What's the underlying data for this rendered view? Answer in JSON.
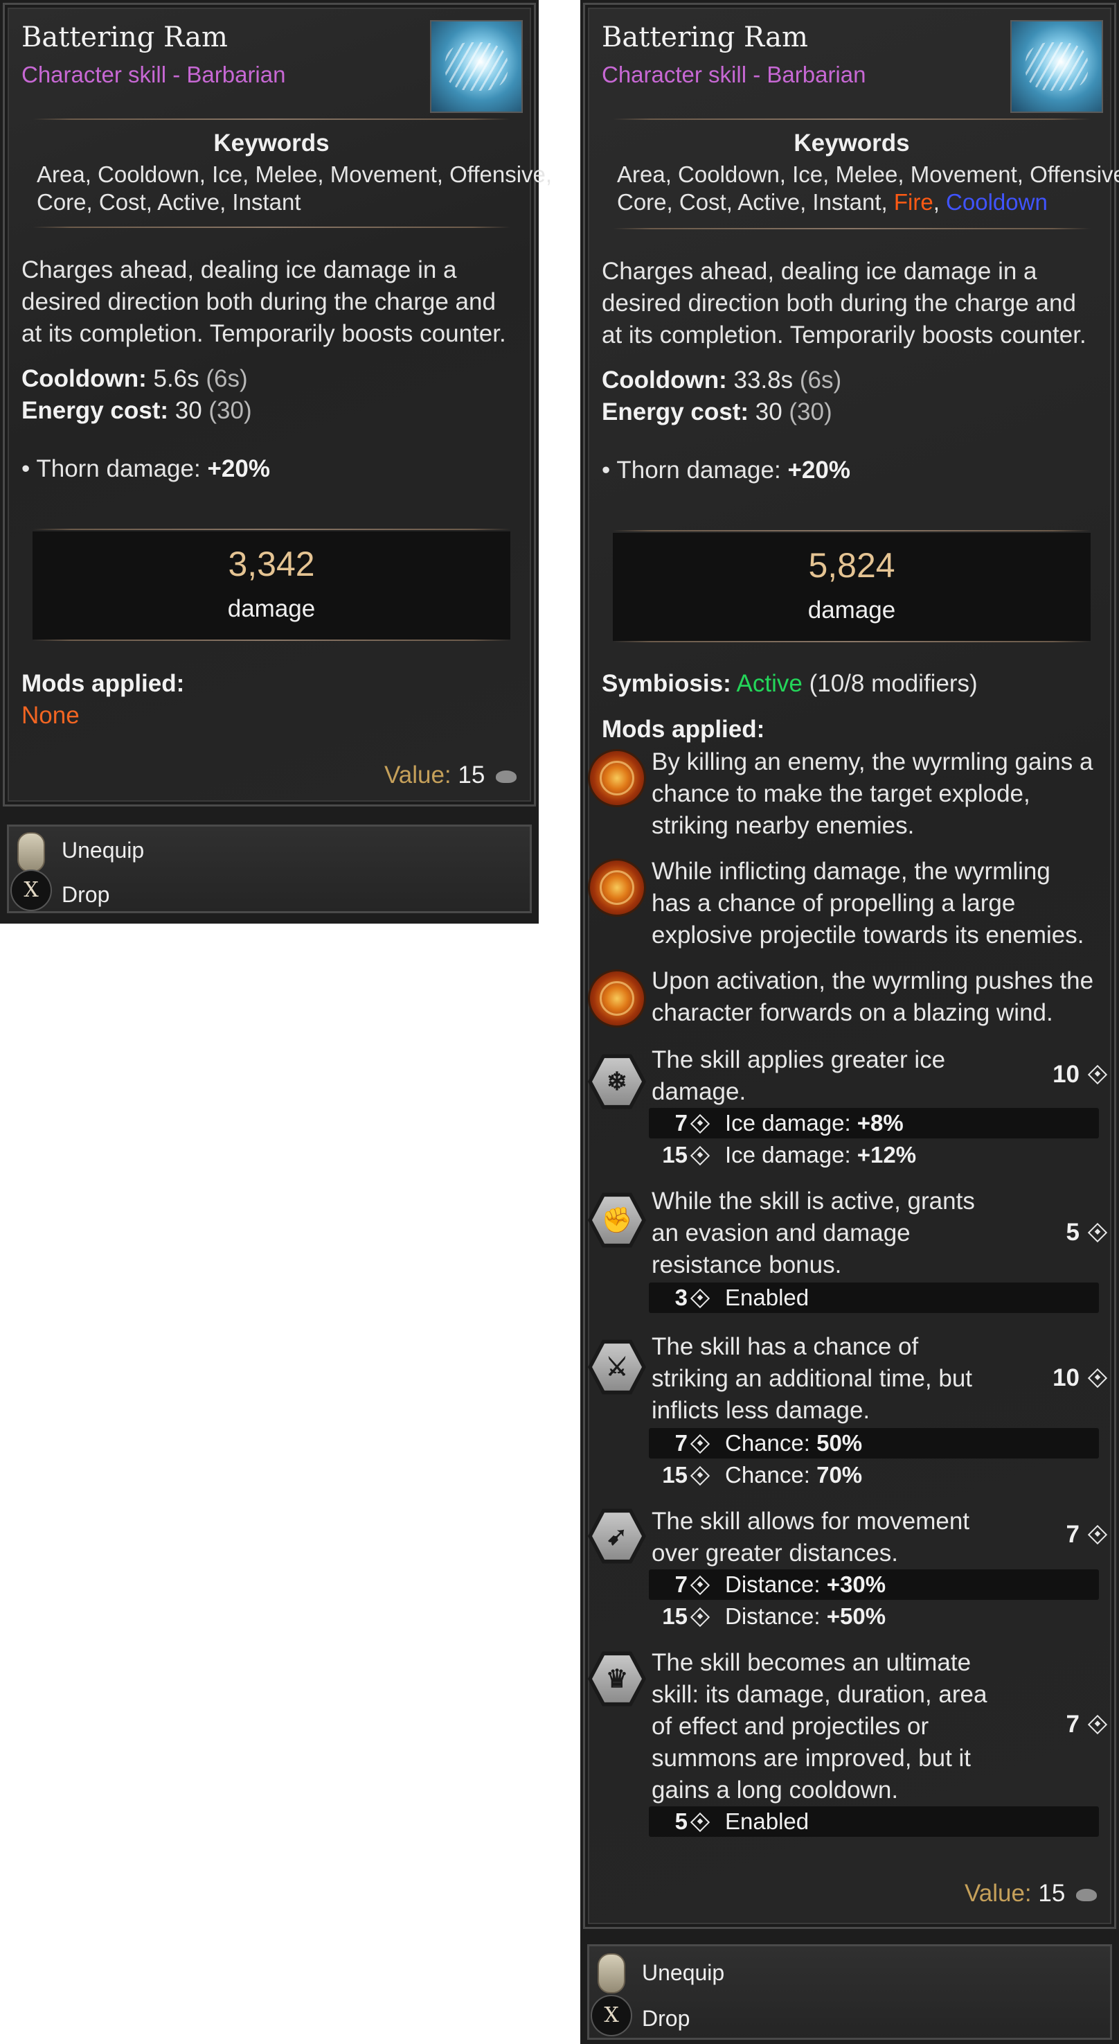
{
  "left": {
    "title": "Battering Ram",
    "subtitle": "Character skill - Barbarian",
    "keywords_title": "Keywords",
    "keywords_line1": "Area, Cooldown, Ice, Melee, Movement, Offensive,",
    "keywords_line2": "Core, Cost, Active, Instant",
    "description": "Charges ahead, dealing ice damage in a desired direction both during the charge and at its completion. Temporarily boosts counter.",
    "cooldown_label": "Cooldown:",
    "cooldown_value": "5.6s",
    "cooldown_base": "(6s)",
    "energy_label": "Energy cost:",
    "energy_value": "30",
    "energy_base": "(30)",
    "thorn_label": "• Thorn damage:",
    "thorn_value": "+20%",
    "damage_value": "3,342",
    "damage_label": "damage",
    "mods_label": "Mods applied:",
    "mods_none": "None",
    "value_label": "Value:",
    "value_amount": "15",
    "unequip": "Unequip",
    "drop": "Drop",
    "drop_key": "X"
  },
  "right": {
    "title": "Battering Ram",
    "subtitle": "Character skill - Barbarian",
    "keywords_title": "Keywords",
    "keywords_line1": "Area, Cooldown, Ice, Melee, Movement, Offensive,",
    "keywords_line2_plain": "Core, Cost, Active, Instant,",
    "keyword_fire": "Fire",
    "keyword_sep": ",",
    "keyword_cooldown": "Cooldown",
    "description": "Charges ahead, dealing ice damage in a desired direction both during the charge and at its completion. Temporarily boosts counter.",
    "cooldown_label": "Cooldown:",
    "cooldown_value": "33.8s",
    "cooldown_base": "(6s)",
    "energy_label": "Energy cost:",
    "energy_value": "30",
    "energy_base": "(30)",
    "thorn_label": "• Thorn damage:",
    "thorn_value": "+20%",
    "damage_value": "5,824",
    "damage_label": "damage",
    "symbiosis_label": "Symbiosis:",
    "symbiosis_status": "Active",
    "symbiosis_detail": "(10/8 modifiers)",
    "mods_label": "Mods applied:",
    "wyrmling_mods": [
      "By killing an enemy, the wyrmling gains a chance to make the target explode, striking nearby enemies.",
      "While inflicting damage, the wyrmling has a chance of propelling a large explosive projectile towards its enemies.",
      "Upon activation, the wyrmling pushes the character forwards on a blazing wind."
    ],
    "skill_mods": [
      {
        "text": "The skill applies greater ice damage.",
        "cost": "10",
        "icon": "ice-shard-icon",
        "tiers": [
          {
            "n": "7",
            "label": "Ice damage: ",
            "value": "+8%"
          },
          {
            "n": "15",
            "label": "Ice damage: ",
            "value": "+12%"
          }
        ]
      },
      {
        "text": "While the skill is active, grants an evasion and damage resistance bonus.",
        "cost": "5",
        "icon": "shield-fist-icon",
        "tiers": [
          {
            "n": "3",
            "label": "Enabled",
            "value": ""
          }
        ]
      },
      {
        "text": "The skill has a chance of striking an additional time, but inflicts less damage.",
        "cost": "10",
        "icon": "double-strike-icon",
        "tiers": [
          {
            "n": "7",
            "label": "Chance: ",
            "value": "50%"
          },
          {
            "n": "15",
            "label": "Chance: ",
            "value": "70%"
          }
        ]
      },
      {
        "text": "The skill allows for movement over greater distances.",
        "cost": "7",
        "icon": "dash-icon",
        "tiers": [
          {
            "n": "7",
            "label": "Distance: ",
            "value": "+30%"
          },
          {
            "n": "15",
            "label": "Distance: ",
            "value": "+50%"
          }
        ]
      },
      {
        "text": "The skill becomes an ultimate skill: its damage, duration, area of effect and projectiles or summons are improved, but it gains a long cooldown.",
        "cost": "7",
        "icon": "ultimate-crown-icon",
        "tiers": [
          {
            "n": "5",
            "label": "Enabled",
            "value": ""
          }
        ]
      }
    ],
    "value_label": "Value:",
    "value_amount": "15",
    "unequip": "Unequip",
    "drop": "Drop",
    "drop_key": "X"
  }
}
